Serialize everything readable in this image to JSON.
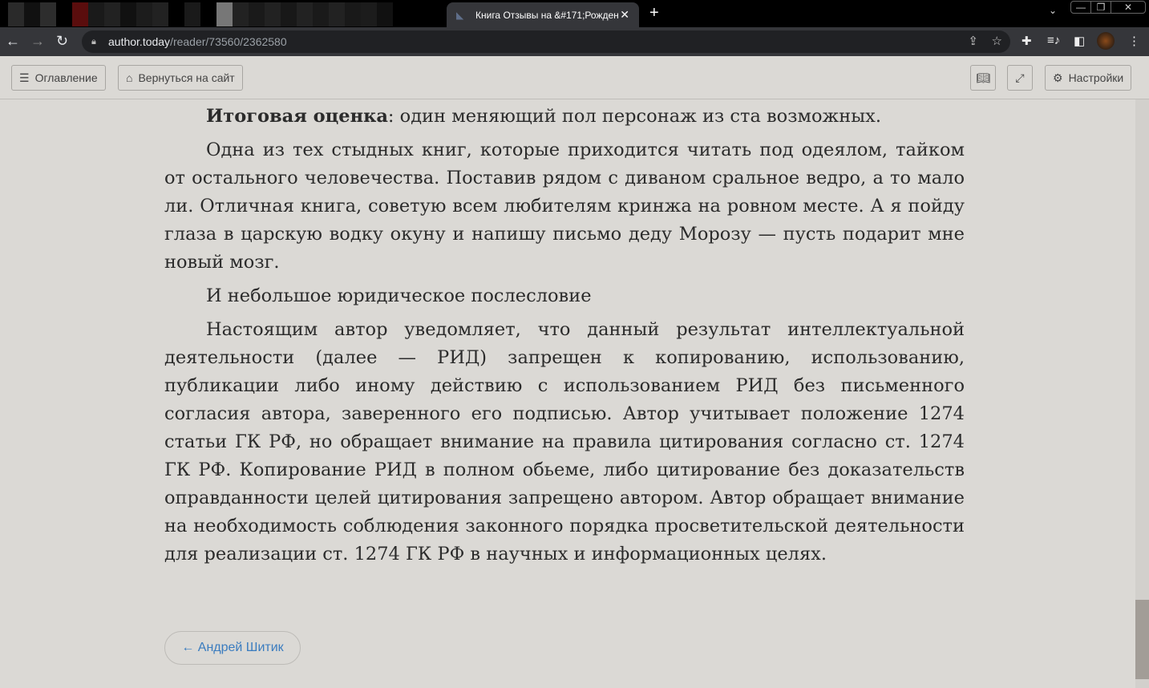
{
  "browser": {
    "tab_title": "Книга Отзывы на &#171;Рожден",
    "url_domain": "author.today",
    "url_path": "/reader/73560/2362580"
  },
  "toolbar": {
    "contents_label": "Оглавление",
    "back_to_site_label": "Вернуться на сайт",
    "settings_label": "Настройки"
  },
  "content": {
    "p1_bold": "Итоговая оценка",
    "p1_rest": ": один меняющий пол персонаж из ста возможных.",
    "p2": "Одна из тех стыдных книг, которые приходится читать под одеялом, тайком от остального человечества. Поставив рядом с диваном сральное ведро, а то мало ли. Отличная книга, советую всем любителям кринжа на ровном месте. А я пойду глаза в царскую водку окуну и напишу письмо деду Морозу — пусть подарит мне новый мозг.",
    "p3": "И небольшое юридическое послесловие",
    "p4": "Настоящим автор уведомляет, что данный результат интеллектуальной деятельности (далее — РИД) запрещен к копированию, использованию, публикации либо иному действию с использованием РИД без письменного согласия автора, заверенного его подписью. Автор учитывает положение 1274 статьи ГК РФ, но обращает внимание на правила цитирования согласно ст. 1274 ГК РФ. Копирование РИД в полном обьеме, либо цитирование без доказательств оправданности целей цитирования запрещено автором. Автор обращает внимание на необходимость соблюдения законного порядка просветительской деятельности для реализации ст. 1274 ГК РФ в научных и информационных целях."
  },
  "nav": {
    "prev_chapter": "← Андрей Шитик"
  },
  "scroll_position_percent": 86
}
